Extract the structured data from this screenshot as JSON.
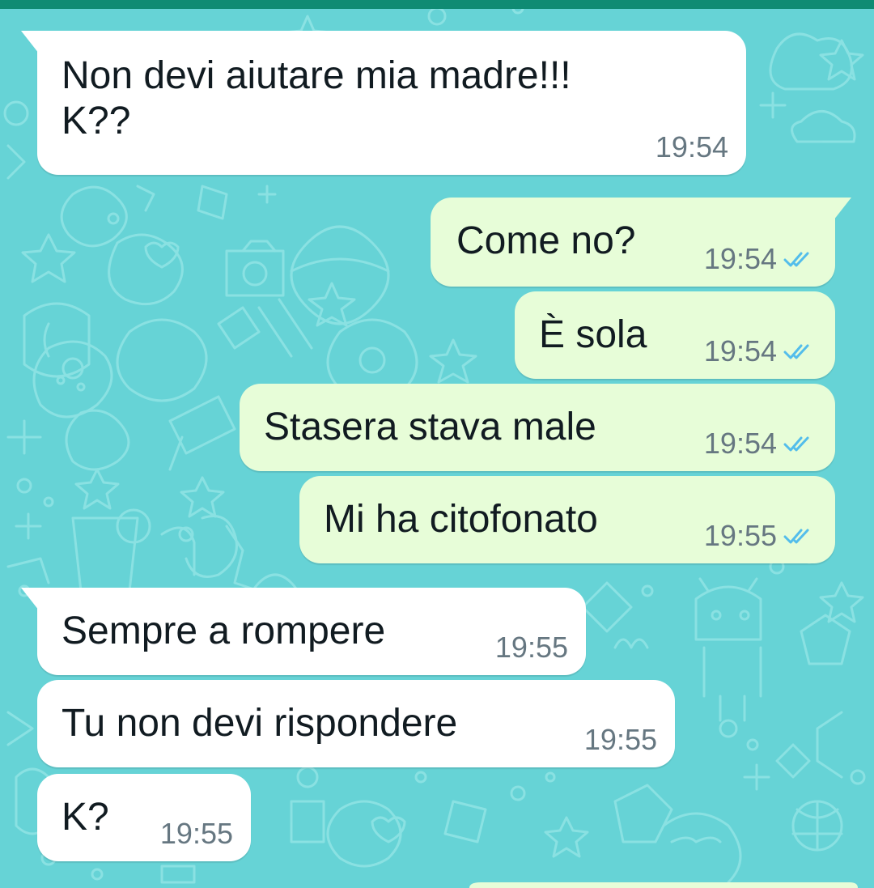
{
  "theme": {
    "wallpaper_color": "#66d3d6",
    "top_bar_color": "#0f8b73",
    "incoming_bubble_color": "#ffffff",
    "outgoing_bubble_color": "#e7fdd8",
    "read_tick_color": "#53bdeb"
  },
  "messages": [
    {
      "direction": "incoming",
      "text": "Non devi aiutare mia madre!!!\nK??",
      "time": "19:54",
      "status_icon": ""
    },
    {
      "direction": "outgoing",
      "text": "Come no?",
      "time": "19:54",
      "status_icon": "double-check-read-icon"
    },
    {
      "direction": "outgoing",
      "text": "È sola",
      "time": "19:54",
      "status_icon": "double-check-read-icon"
    },
    {
      "direction": "outgoing",
      "text": "Stasera stava male",
      "time": "19:54",
      "status_icon": "double-check-read-icon"
    },
    {
      "direction": "outgoing",
      "text": "Mi ha citofonato",
      "time": "19:55",
      "status_icon": "double-check-read-icon"
    },
    {
      "direction": "incoming",
      "text": "Sempre a rompere",
      "time": "19:55",
      "status_icon": ""
    },
    {
      "direction": "incoming",
      "text": "Tu non devi rispondere",
      "time": "19:55",
      "status_icon": ""
    },
    {
      "direction": "incoming",
      "text": "K?",
      "time": "19:55",
      "status_icon": ""
    }
  ]
}
